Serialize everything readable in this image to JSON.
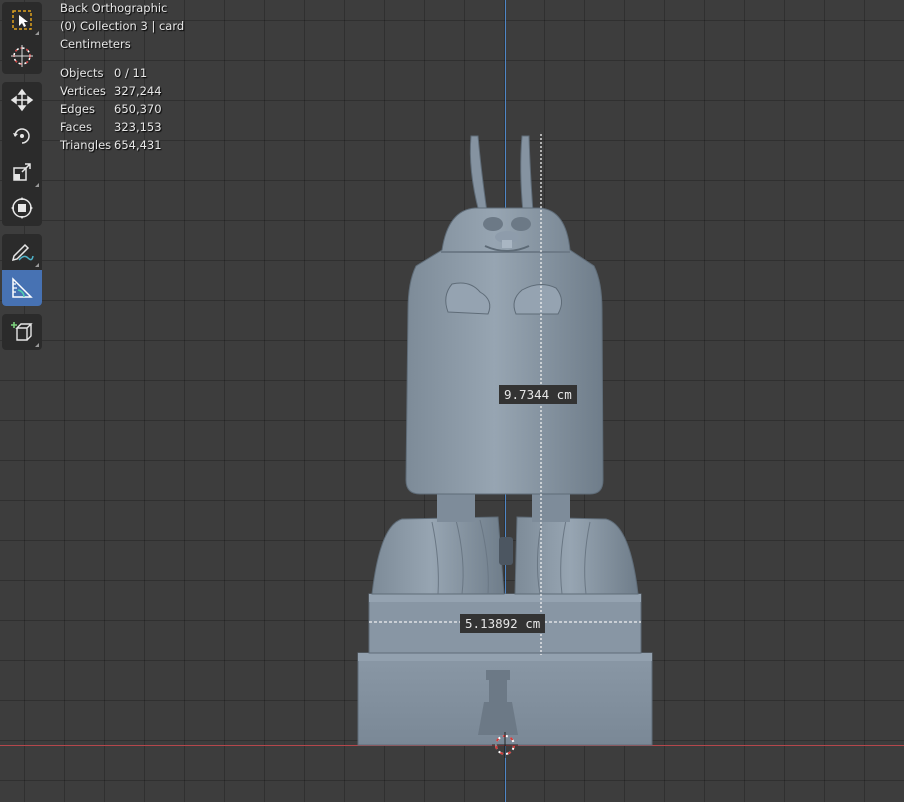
{
  "view": {
    "projection": "Back Orthographic",
    "collection": "(0) Collection 3 | card",
    "units": "Centimeters"
  },
  "stats": [
    {
      "label": "Objects",
      "value": "0 / 11"
    },
    {
      "label": "Vertices",
      "value": "327,244"
    },
    {
      "label": "Edges",
      "value": "650,370"
    },
    {
      "label": "Faces",
      "value": "323,153"
    },
    {
      "label": "Triangles",
      "value": "654,431"
    }
  ],
  "measurements": {
    "height": "9.7344 cm",
    "width": "5.13892 cm"
  },
  "colors": {
    "viewport_bg": "#3d3d3d",
    "model": "#8796a4",
    "y_axis": "#4f86c6",
    "x_axis": "#b5474c",
    "active_tool": "#4772b3"
  },
  "toolbar": {
    "tools": [
      "select-box",
      "cursor",
      "move",
      "rotate",
      "scale",
      "transform",
      "annotate",
      "measure",
      "add-cube"
    ],
    "active": "measure"
  }
}
